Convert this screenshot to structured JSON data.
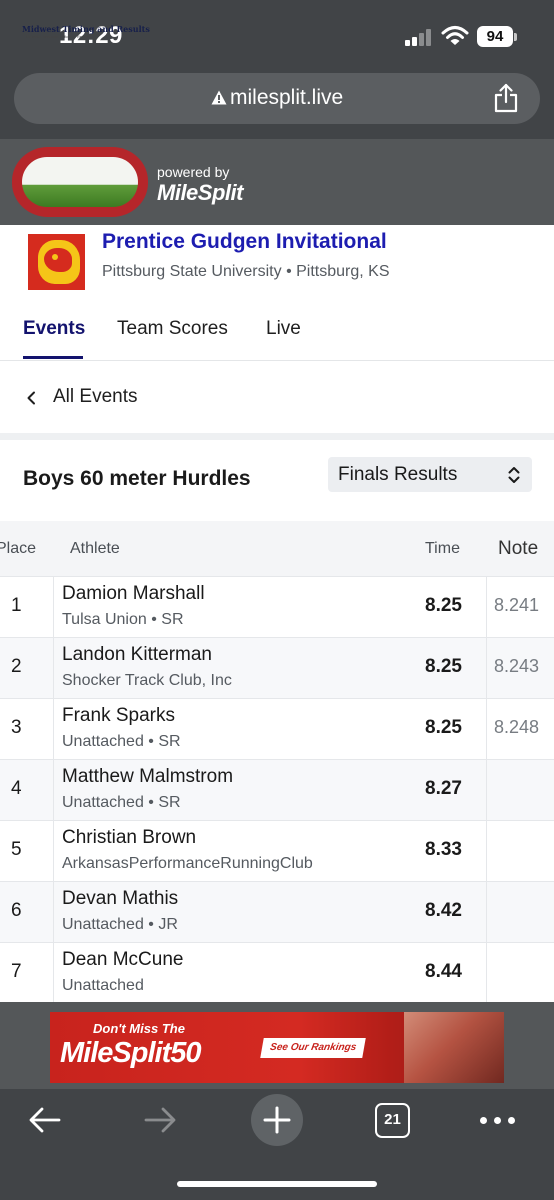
{
  "status_bar": {
    "time": "12:29",
    "battery": "94"
  },
  "browser": {
    "url": "milesplit.live",
    "tab_count": "21"
  },
  "banner": {
    "timing_logo_text": "Midwest Timing and Results",
    "timing_logo_tagline": "Reliable. Accurate. Efficient. Results.",
    "powered_by": "powered by",
    "brand": "MileSplit"
  },
  "meet": {
    "title": "Prentice Gudgen Invitational",
    "location": "Pittsburg State University • Pittsburg, KS"
  },
  "tabs": [
    {
      "label": "Events",
      "active": true
    },
    {
      "label": "Team Scores",
      "active": false
    },
    {
      "label": "Live",
      "active": false
    }
  ],
  "back_link": "All Events",
  "event": {
    "title": "Boys 60 meter Hurdles",
    "selected_view": "Finals Results"
  },
  "table": {
    "headers": {
      "place": "Place",
      "athlete": "Athlete",
      "time": "Time",
      "note": "Note"
    },
    "rows": [
      {
        "place": "1",
        "name": "Damion Marshall",
        "team": "Tulsa Union • SR",
        "time": "8.25",
        "note": "8.241"
      },
      {
        "place": "2",
        "name": "Landon Kitterman",
        "team": "Shocker Track Club, Inc",
        "time": "8.25",
        "note": "8.243"
      },
      {
        "place": "3",
        "name": "Frank Sparks",
        "team": "Unattached • SR",
        "time": "8.25",
        "note": "8.248"
      },
      {
        "place": "4",
        "name": "Matthew Malmstrom",
        "team": "Unattached • SR",
        "time": "8.27",
        "note": ""
      },
      {
        "place": "5",
        "name": "Christian Brown",
        "team": "ArkansasPerformanceRunningClub",
        "time": "8.33",
        "note": ""
      },
      {
        "place": "6",
        "name": "Devan Mathis",
        "team": "Unattached • JR",
        "time": "8.42",
        "note": ""
      },
      {
        "place": "7",
        "name": "Dean McCune",
        "team": "Unattached",
        "time": "8.44",
        "note": ""
      }
    ]
  },
  "ad": {
    "line1": "Don't Miss The",
    "line2": "MileSplit50",
    "cta": "See Our Rankings"
  },
  "colors": {
    "chrome": "#414447",
    "meet_title": "#1d1db0",
    "active_tab": "#13136e",
    "ad_red": "#c8231d"
  },
  "icons": [
    "warning-icon",
    "share-icon",
    "chevron-left-icon",
    "select-arrows-icon",
    "back-arrow-icon",
    "forward-arrow-icon",
    "plus-icon",
    "tabs-icon",
    "more-icon"
  ]
}
